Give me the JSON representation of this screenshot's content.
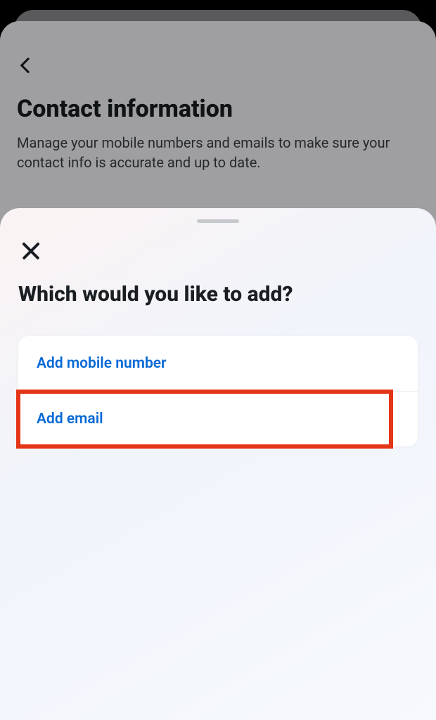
{
  "page": {
    "title": "Contact information",
    "description": "Manage your mobile numbers and emails to make sure your contact info is accurate and up to date."
  },
  "sheet": {
    "title": "Which would you like to add?",
    "options": {
      "mobile": "Add mobile number",
      "email": "Add email"
    }
  }
}
